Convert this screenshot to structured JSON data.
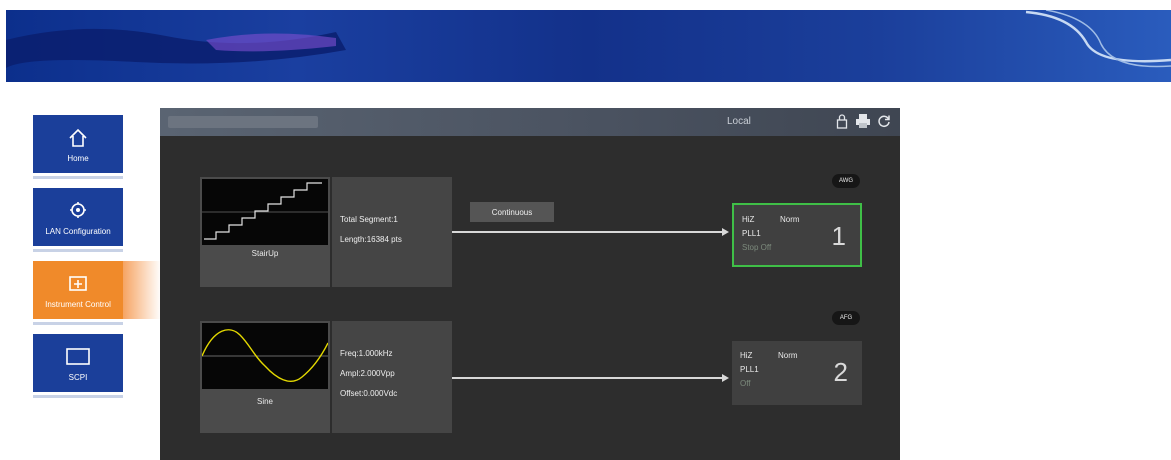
{
  "nav": {
    "items": [
      {
        "label": "Home",
        "icon": "home-icon"
      },
      {
        "label": "LAN Configuration",
        "icon": "network-config-icon"
      },
      {
        "label": "Instrument Control",
        "icon": "instrument-control-icon"
      },
      {
        "label": "SCPI",
        "icon": "scpi-window-icon"
      }
    ]
  },
  "panel": {
    "mode_label": "Local",
    "tools": [
      "lock-icon",
      "print-icon",
      "refresh-icon"
    ]
  },
  "channels": [
    {
      "waveform_name": "StairUp",
      "info": [
        "Total Segment:1",
        "Length:16384 pts"
      ],
      "run_mode": "Continuous",
      "badge": "AWG",
      "out_line1_left": "HiZ",
      "out_line1_right": "Norm",
      "out_line2": "PLL1",
      "out_status": "Stop Off",
      "number": "1"
    },
    {
      "waveform_name": "Sine",
      "info": [
        "Freq:1.000kHz",
        "Ampl:2.000Vpp",
        "Offset:0.000Vdc"
      ],
      "badge": "AFG",
      "out_line1_left": "HiZ",
      "out_line1_right": "Norm",
      "out_line2": "PLL1",
      "out_status": "Off",
      "number": "2"
    }
  ],
  "colors": {
    "banner": "#1b3f9a",
    "nav_active": "#f08a2a",
    "panel_bg": "#2d2d2d",
    "active_output_border": "#3fbf47",
    "sine_trace": "#e3d800"
  }
}
